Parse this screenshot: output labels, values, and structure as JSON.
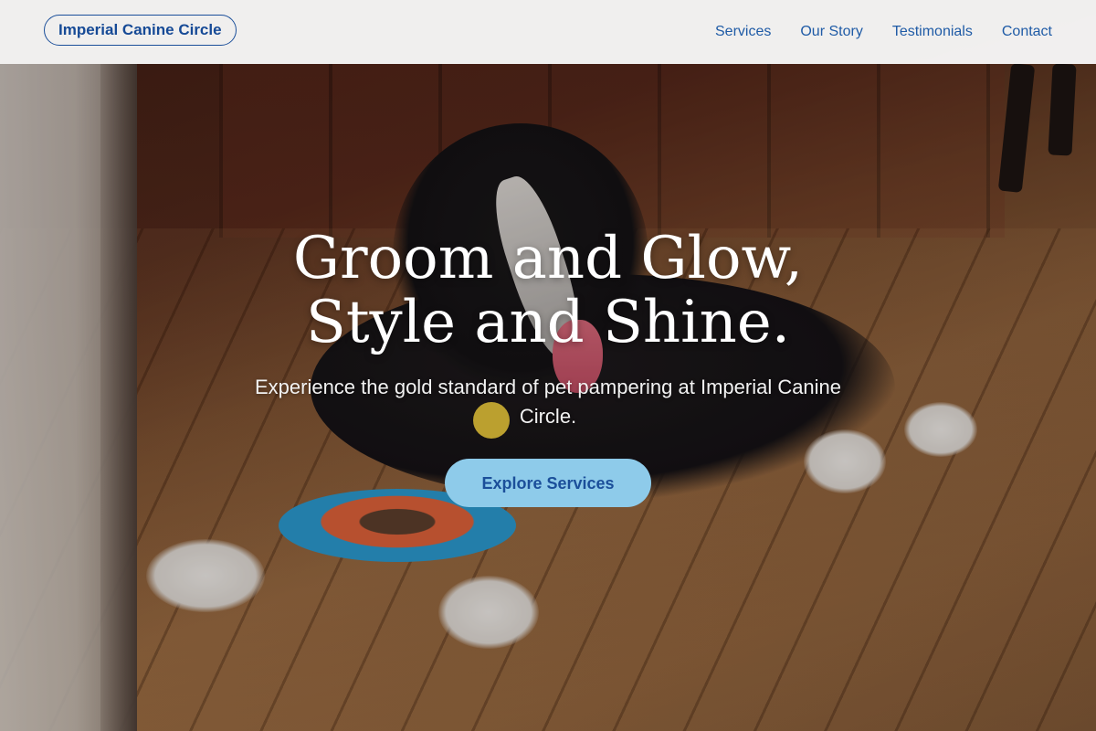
{
  "header": {
    "logo_text": "Imperial Canine Circle",
    "nav": [
      {
        "label": "Services"
      },
      {
        "label": "Our Story"
      },
      {
        "label": "Testimonials"
      },
      {
        "label": "Contact"
      }
    ]
  },
  "hero": {
    "headline_line1": "Groom and Glow,",
    "headline_line2": "Style and Shine.",
    "subtitle": "Experience the gold standard of pet pampering at Imperial Canine Circle.",
    "cta_label": "Explore Services",
    "image_subject": "dog lying on wooden porch with frisbee"
  },
  "colors": {
    "brand_blue": "#1b4f9a",
    "cta_background": "#8ecbea",
    "header_background": "#f8f8f8",
    "headline_color": "#ffffff"
  }
}
